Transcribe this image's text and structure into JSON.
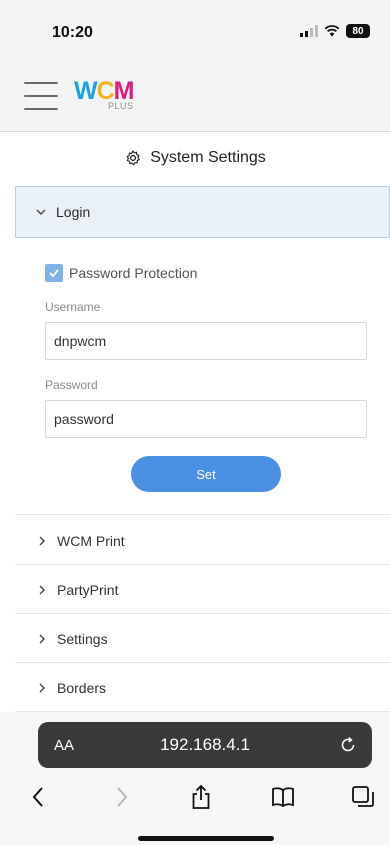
{
  "status_bar": {
    "time": "10:20",
    "battery": "80"
  },
  "header": {
    "logo_main": "WCM",
    "logo_sub": "PLUS"
  },
  "page": {
    "title": "System Settings"
  },
  "login_section": {
    "label": "Login",
    "password_protection_label": "Password Protection",
    "username_label": "Username",
    "username_value": "dnpwcm",
    "password_label": "Password",
    "password_value": "password",
    "set_button": "Set"
  },
  "sections": [
    "WCM Print",
    "PartyPrint",
    "Settings",
    "Borders"
  ],
  "browser": {
    "aa_label": "AA",
    "url": "192.168.4.1"
  },
  "colors": {
    "accent": "#4a90e2",
    "selected_bg": "#eaf1f6",
    "logo_blue": "#1aa3df",
    "logo_yellow": "#f2b51f",
    "logo_magenta": "#e0197d"
  }
}
